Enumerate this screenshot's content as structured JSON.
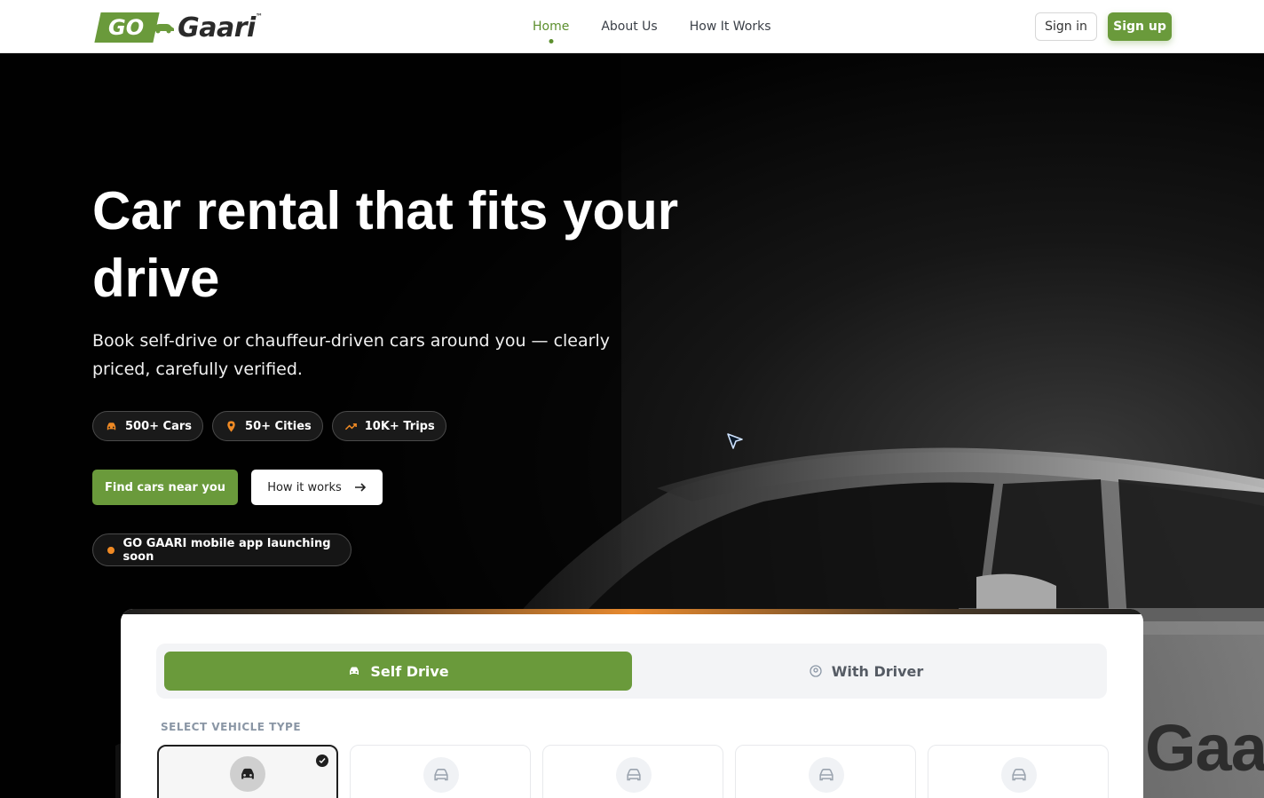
{
  "brand": {
    "logo_go": "GO",
    "logo_name": "Gaari",
    "primary_color": "#6a9a3b",
    "accent_color": "#f08a24"
  },
  "nav": {
    "items": [
      {
        "label": "Home",
        "active": true
      },
      {
        "label": "About Us",
        "active": false
      },
      {
        "label": "How It Works",
        "active": false
      }
    ],
    "sign_in": "Sign in",
    "sign_up": "Sign up"
  },
  "hero": {
    "title": "Car rental that fits your drive",
    "subtitle": "Book self-drive or chauffeur-driven cars around you — clearly priced, carefully verified.",
    "stats": [
      {
        "icon": "car-icon",
        "label": "500+ Cars"
      },
      {
        "icon": "map-pin-icon",
        "label": "50+ Cities"
      },
      {
        "icon": "trending-up-icon",
        "label": "10K+ Trips"
      }
    ],
    "cta_primary": "Find cars near you",
    "cta_secondary": "How it works",
    "app_notice": "GO GAARI mobile app launching soon",
    "background_text": "Gaar"
  },
  "booking": {
    "modes": [
      {
        "label": "Self Drive",
        "icon": "car-icon",
        "active": true
      },
      {
        "label": "With Driver",
        "icon": "user-circle-icon",
        "active": false
      }
    ],
    "section_label": "SELECT VEHICLE TYPE",
    "vehicle_types": [
      {
        "icon": "car-icon",
        "selected": true
      },
      {
        "icon": "car-icon",
        "selected": false
      },
      {
        "icon": "car-icon",
        "selected": false
      },
      {
        "icon": "car-icon",
        "selected": false
      },
      {
        "icon": "car-icon",
        "selected": false
      }
    ]
  }
}
